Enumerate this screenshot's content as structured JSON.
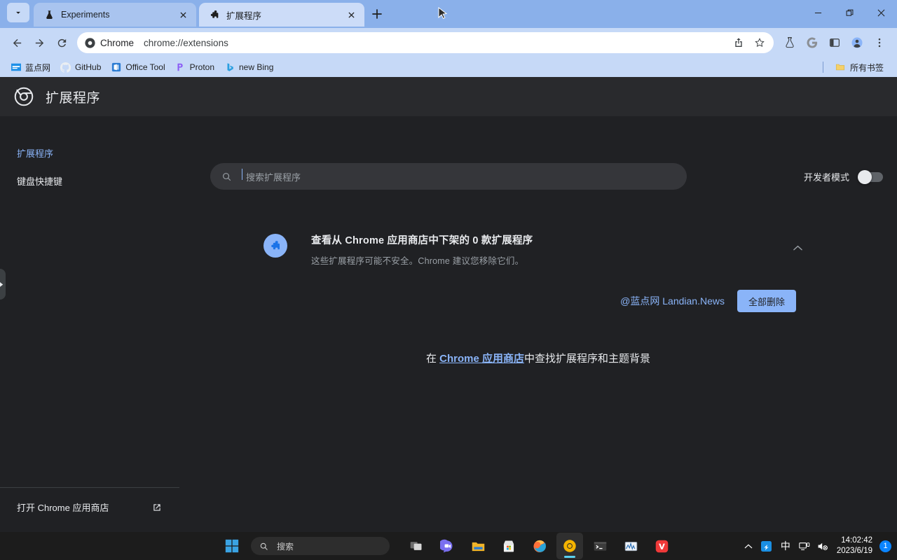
{
  "window": {
    "controls": {
      "minimize": "minimize-icon",
      "maximize": "restore-icon",
      "close": "close-icon"
    }
  },
  "tabstrip": {
    "tab_search_icon": "chevron-down-icon",
    "new_tab_label": "+",
    "tabs": [
      {
        "title": "Experiments",
        "favicon": "flask-icon",
        "active": false
      },
      {
        "title": "扩展程序",
        "favicon": "puzzle-icon",
        "active": true
      }
    ]
  },
  "toolbar": {
    "back_icon": "back-arrow-icon",
    "forward_icon": "forward-arrow-icon",
    "reload_icon": "reload-icon",
    "omnibox": {
      "chip_label": "Chrome",
      "chip_icon": "chrome-icon",
      "url": "chrome://extensions",
      "share_icon": "share-icon",
      "bookmark_icon": "star-icon"
    },
    "extension_buttons": [
      {
        "name": "experiments-flask-icon"
      },
      {
        "name": "google-g-icon"
      },
      {
        "name": "side-panel-icon"
      },
      {
        "name": "profile-avatar-icon"
      },
      {
        "name": "chrome-menu-icon"
      }
    ]
  },
  "bookmarks": {
    "items": [
      {
        "label": "蓝点网",
        "icon": "landian-icon"
      },
      {
        "label": "GitHub",
        "icon": "github-icon"
      },
      {
        "label": "Office Tool",
        "icon": "office-icon"
      },
      {
        "label": "Proton",
        "icon": "proton-icon"
      },
      {
        "label": "new Bing",
        "icon": "bing-icon"
      }
    ],
    "all_bookmarks_label": "所有书签",
    "all_bookmarks_icon": "folder-icon"
  },
  "extensions_page": {
    "logo_icon": "chrome-logo-icon",
    "title": "扩展程序",
    "search": {
      "placeholder": "搜索扩展程序",
      "value": "",
      "icon": "search-icon"
    },
    "dev_mode": {
      "label": "开发者模式",
      "enabled": false
    },
    "sidebar": {
      "items": [
        {
          "label": "扩展程序",
          "selected": true
        },
        {
          "label": "键盘快捷键",
          "selected": false
        }
      ],
      "footer": {
        "label": "打开 Chrome 应用商店",
        "icon": "open-in-new-icon"
      }
    },
    "side_panel_tab_icon": "expand-right-icon",
    "notice": {
      "icon": "puzzle-piece-icon",
      "title": "查看从 Chrome 应用商店中下架的 0 款扩展程序",
      "subtitle": "这些扩展程序可能不安全。Chrome 建议您移除它们。",
      "collapse_icon": "chevron-up-icon"
    },
    "watermark": "@蓝点网 Landian.News",
    "remove_all_label": "全部删除",
    "find_line": {
      "prefix": "在 ",
      "link": "Chrome 应用商店",
      "suffix": "中查找扩展程序和主题背景"
    }
  },
  "taskbar": {
    "start_icon": "windows-start-icon",
    "search": {
      "placeholder": "搜索",
      "icon": "search-icon"
    },
    "apps": [
      {
        "name": "task-view-icon",
        "active": false
      },
      {
        "name": "chat-icon",
        "active": false
      },
      {
        "name": "file-explorer-icon",
        "active": false
      },
      {
        "name": "microsoft-store-icon",
        "active": false
      },
      {
        "name": "firefox-icon",
        "active": false
      },
      {
        "name": "chrome-canary-icon",
        "active": true
      },
      {
        "name": "terminal-icon",
        "active": false
      },
      {
        "name": "task-manager-icon",
        "active": false
      },
      {
        "name": "vivaldi-icon",
        "active": false
      }
    ],
    "tray": {
      "overflow_icon": "chevron-up-icon",
      "items": [
        {
          "name": "onedrive-icon"
        },
        {
          "name": "ime-indicator",
          "label": "中"
        },
        {
          "name": "network-display-icon"
        },
        {
          "name": "volume-muted-icon"
        }
      ],
      "time": "14:02:42",
      "date": "2023/6/19",
      "notification_count": "1"
    }
  },
  "colors": {
    "tabstrip_bg": "#8ab0ea",
    "toolbar_bg": "#c6d9f7",
    "active_tab": "#ccdcf8",
    "page_bg": "#202124",
    "header_bg": "#292a2d",
    "accent_blue": "#8ab4f8",
    "taskbar_bg": "#1c1c1c"
  }
}
